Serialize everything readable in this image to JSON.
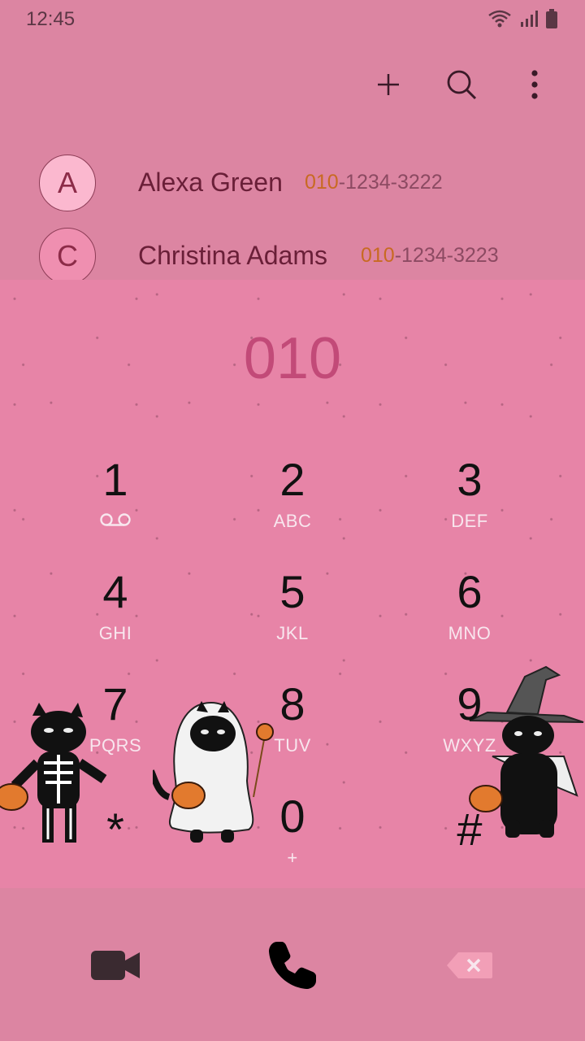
{
  "status_bar": {
    "time": "12:45"
  },
  "contacts": [
    {
      "initial": "A",
      "name": "Alexa Green",
      "number_match": "010",
      "number_rest": "-1234-3222"
    },
    {
      "initial": "C",
      "name": "Christina Adams",
      "number_match": "010",
      "number_rest": "-1234-3223"
    }
  ],
  "dialer": {
    "typed_number": "010",
    "keys": [
      {
        "digit": "1",
        "letters": ""
      },
      {
        "digit": "2",
        "letters": "ABC"
      },
      {
        "digit": "3",
        "letters": "DEF"
      },
      {
        "digit": "4",
        "letters": "GHI"
      },
      {
        "digit": "5",
        "letters": "JKL"
      },
      {
        "digit": "6",
        "letters": "MNO"
      },
      {
        "digit": "7",
        "letters": "PQRS"
      },
      {
        "digit": "8",
        "letters": "TUV"
      },
      {
        "digit": "9",
        "letters": "WXYZ"
      },
      {
        "digit": "*",
        "letters": ""
      },
      {
        "digit": "0",
        "letters": "+"
      },
      {
        "digit": "#",
        "letters": ""
      }
    ]
  },
  "icons": {
    "add": "plus-icon",
    "search": "search-icon",
    "more": "more-vertical-icon",
    "video_call": "video-camera-icon",
    "call": "phone-icon",
    "backspace": "backspace-icon"
  },
  "colors": {
    "background": "#dc85a2",
    "dialpad": "#e784a7",
    "typed_number": "#c24a78",
    "match_highlight": "#c86a22"
  }
}
